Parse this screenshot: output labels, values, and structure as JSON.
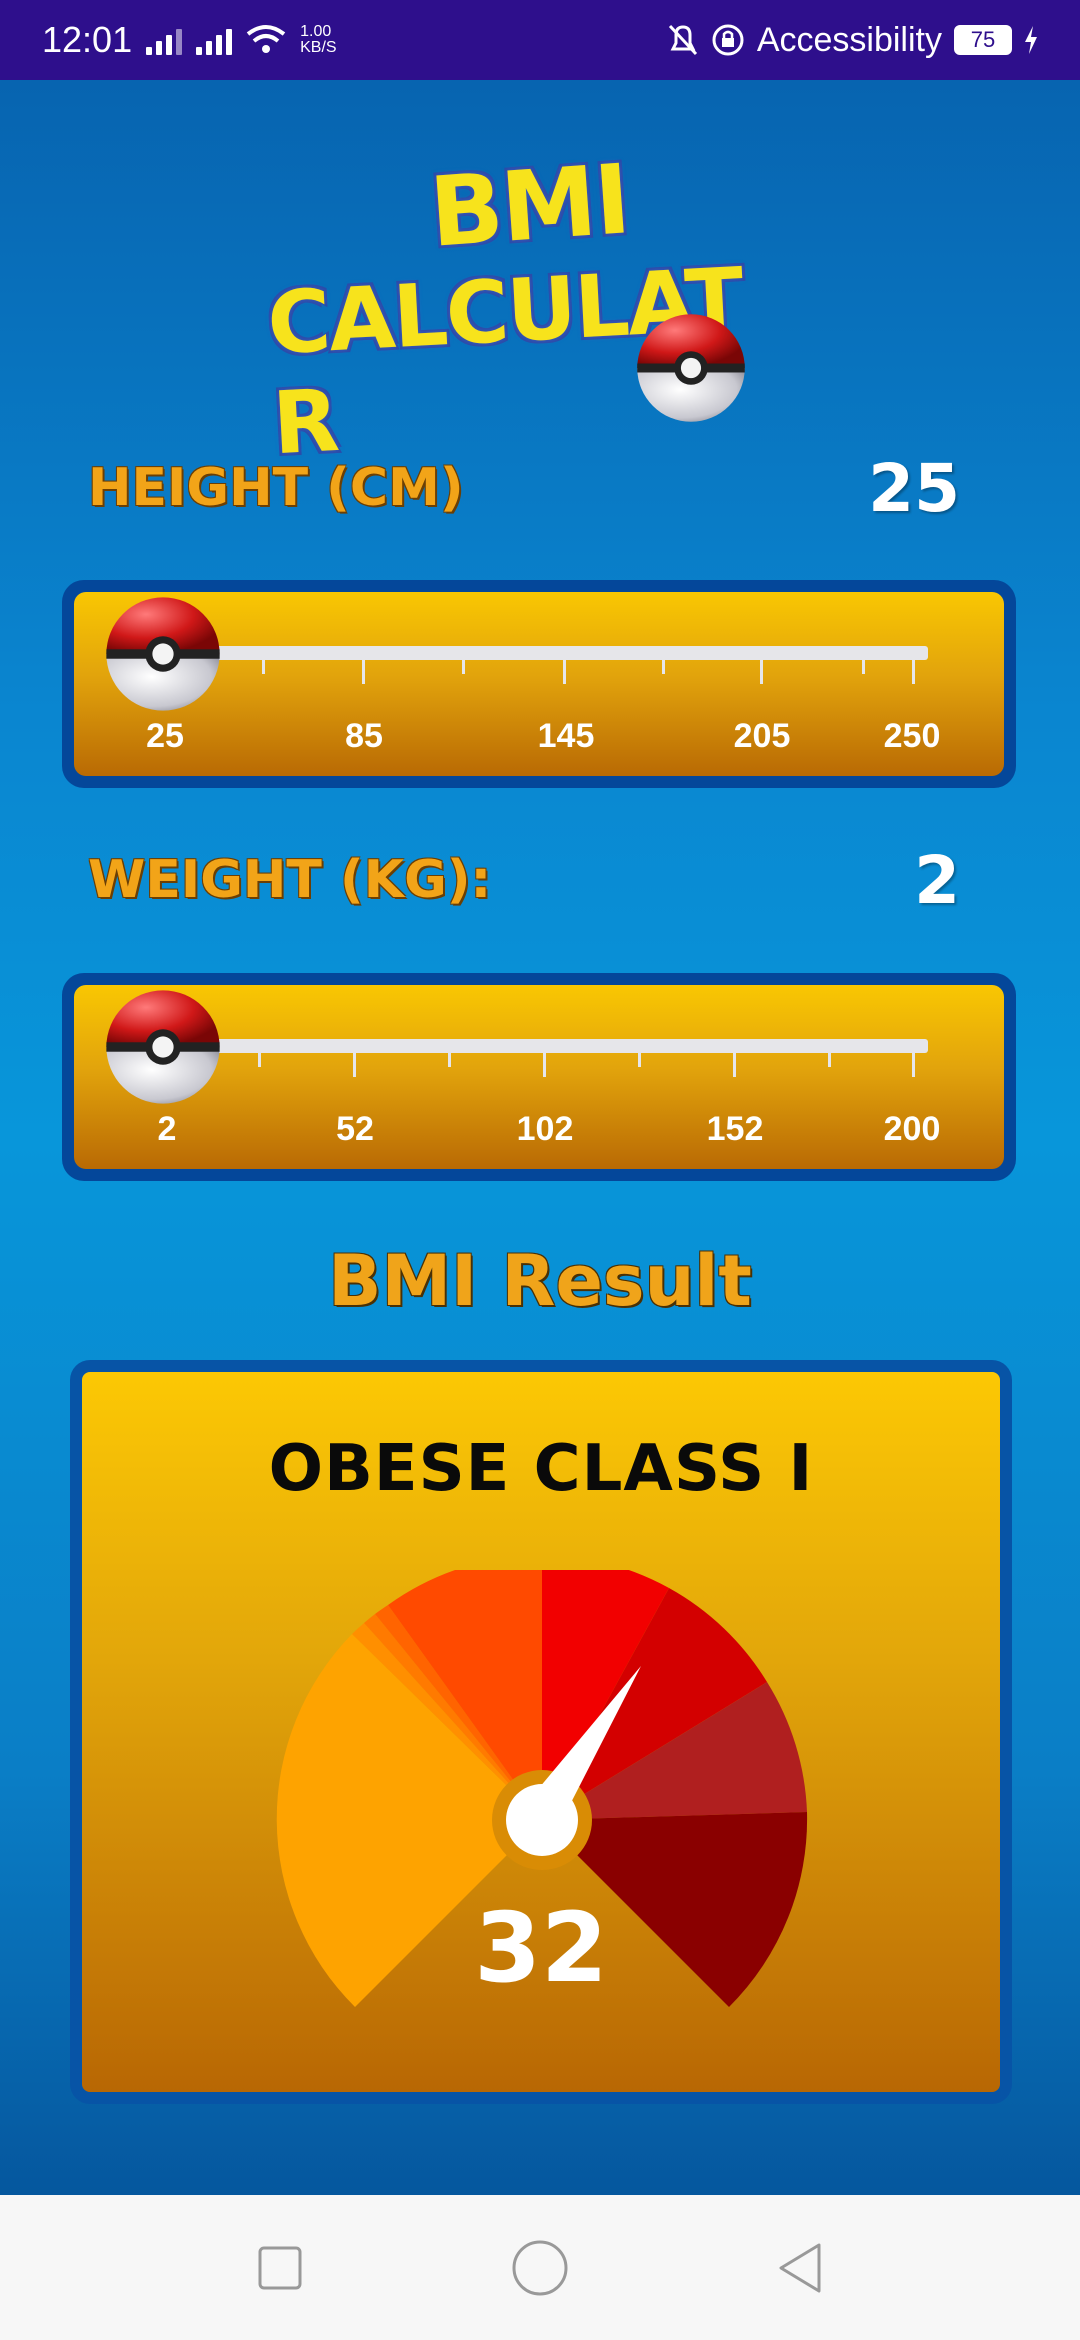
{
  "status_bar": {
    "time": "12:01",
    "speed_value": "1.00",
    "speed_unit": "KB/S",
    "accessibility": "Accessibility",
    "battery": "75"
  },
  "logo": {
    "line1": "BMI",
    "line2": "CALCULAT    R"
  },
  "height": {
    "label": "HEIGHT (CM)",
    "value": "25",
    "ticks": [
      "25",
      "85",
      "145",
      "205",
      "250"
    ]
  },
  "weight": {
    "label": "WEIGHT (KG):",
    "value": "2",
    "ticks": [
      "2",
      "52",
      "102",
      "152",
      "200"
    ]
  },
  "result": {
    "heading": "BMI Result",
    "category": "OBESE CLASS I",
    "bmi": "32"
  },
  "colors": {
    "gauge_orange": "#fea300",
    "gauge_red_orange": "#ff4a00",
    "gauge_red": "#f20000",
    "gauge_dark_red": "#8a0000"
  },
  "icons": {
    "nav_recent": "square-icon",
    "nav_home": "circle-icon",
    "nav_back": "triangle-back-icon"
  }
}
